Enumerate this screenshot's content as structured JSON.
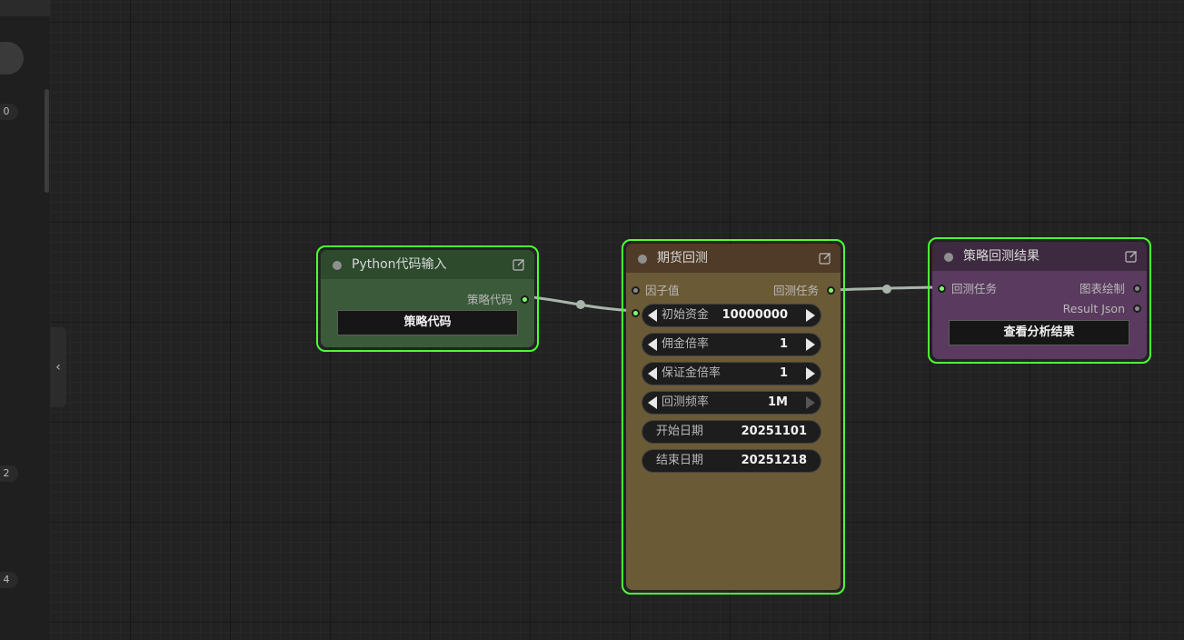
{
  "sidebar": {
    "ticks": [
      "0",
      "2",
      "4"
    ],
    "collapse_icon": "chevron-left-icon"
  },
  "colors": {
    "selected_border": "#4dff37",
    "link": "#a9b4ac",
    "socket_connected": "#7dff6a"
  },
  "nodes": {
    "python_input": {
      "title": "Python代码输入",
      "output": "策略代码",
      "button": "策略代码",
      "header_color": "#2d4a2d",
      "body_color": "#3a5a3a"
    },
    "futures_backtest": {
      "title": "期货回测",
      "input": "因子值",
      "output": "回测任务",
      "header_color": "#4f3b27",
      "body_color": "#6b5a36",
      "widgets": [
        {
          "label": "初始资金",
          "value": "10000000"
        },
        {
          "label": "佣金倍率",
          "value": "1"
        },
        {
          "label": "保证金倍率",
          "value": "1"
        },
        {
          "label": "回测频率",
          "value": "1M"
        },
        {
          "label": "开始日期",
          "value": "20251101"
        },
        {
          "label": "结束日期",
          "value": "20251218"
        }
      ]
    },
    "strategy_result": {
      "title": "策略回测结果",
      "input": "回测任务",
      "outputs": [
        "图表绘制",
        "Result Json"
      ],
      "button": "查看分析结果",
      "header_color": "#3e2a40",
      "body_color": "#5a3a5e"
    }
  }
}
